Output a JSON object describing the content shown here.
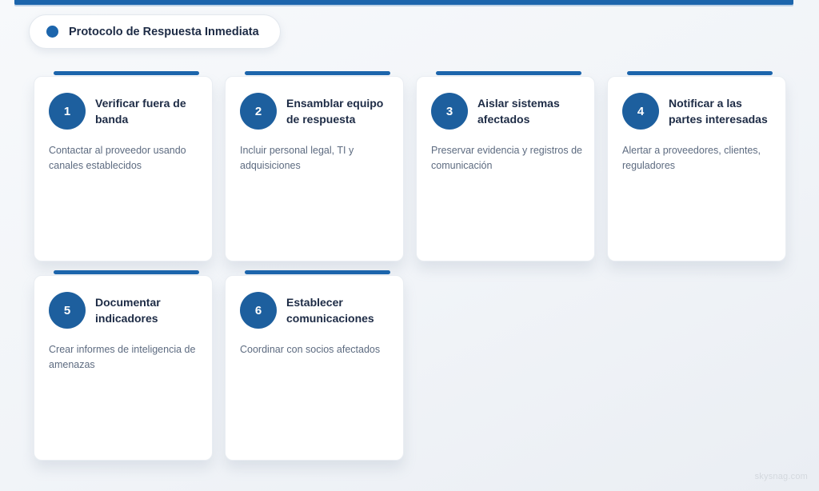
{
  "header": {
    "title": "Protocolo de Respuesta Inmediata"
  },
  "colors": {
    "accent_blue": "#1c65ac",
    "circle_blue": "#1d5f9e",
    "title_text": "#1d2b45",
    "description_text": "#5d6b80",
    "card_background": "#ffffff",
    "page_background": "#f1f4f8"
  },
  "cards": [
    {
      "number": "1",
      "title": "Verificar fuera de banda",
      "description": "Contactar al proveedor usando canales establecidos"
    },
    {
      "number": "2",
      "title": "Ensamblar equipo de respuesta",
      "description": "Incluir personal legal, TI y adquisiciones"
    },
    {
      "number": "3",
      "title": "Aislar sistemas afectados",
      "description": "Preservar evidencia y registros de comunicación"
    },
    {
      "number": "4",
      "title": "Notificar a las partes interesadas",
      "description": "Alertar a proveedores, clientes, reguladores"
    },
    {
      "number": "5",
      "title": "Documentar indicadores",
      "description": "Crear informes de inteligencia de amenazas"
    },
    {
      "number": "6",
      "title": "Establecer comunicaciones",
      "description": "Coordinar con socios afectados"
    }
  ],
  "footer": {
    "watermark": "skysnag.com"
  }
}
